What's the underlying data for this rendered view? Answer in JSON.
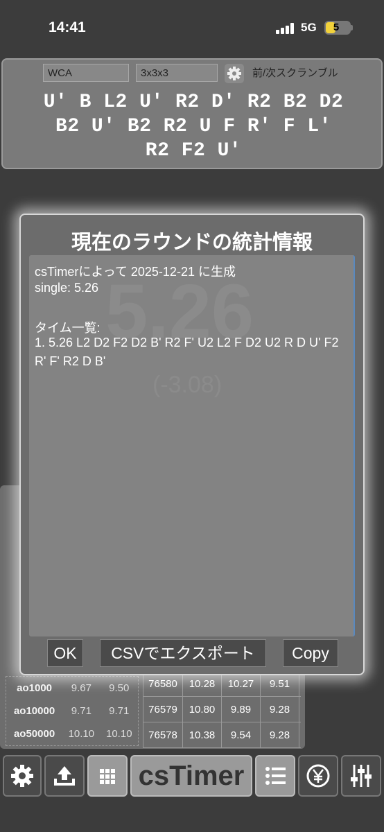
{
  "status": {
    "time": "14:41",
    "network": "5G",
    "battery": "5"
  },
  "scramble": {
    "event_field": "WCA",
    "puzzle_field": "3x3x3",
    "link_label": "前/次スクランブル",
    "lines": [
      "U' B L2 U' R2 D' R2 B2 D2",
      "B2 U' B2 R2 U F R' F L'",
      "R2 F2 U'"
    ]
  },
  "background": {
    "ghost_time": "5.26",
    "ghost_delta": "(-3.08)",
    "ao_rows": [
      {
        "label": "ao1000",
        "v1": "9.67",
        "v2": "9.50"
      },
      {
        "label": "ao10000",
        "v1": "9.71",
        "v2": "9.71"
      },
      {
        "label": "ao50000",
        "v1": "10.10",
        "v2": "10.10"
      }
    ],
    "time_rows": [
      {
        "n": "76580",
        "a": "10.28",
        "b": "10.27",
        "c": "9.51"
      },
      {
        "n": "76579",
        "a": "10.80",
        "b": "9.89",
        "c": "9.28"
      },
      {
        "n": "76578",
        "a": "10.38",
        "b": "9.54",
        "c": "9.28"
      }
    ]
  },
  "modal": {
    "title": "現在のラウンドの統計情報",
    "line1": "csTimerによって 2025-12-21 に生成",
    "line2": "single: 5.26",
    "line3": "タイム一覧:",
    "line4": "1. 5.26   L2 D2 F2 D2 B' R2 F' U2 L2 F D2 U2 R D U' F2 R' F' R2 D B'",
    "ok_label": "OK",
    "csv_label": "CSVでエクスポート",
    "copy_label": "Copy"
  },
  "toolbar": {
    "logo": "csTimer"
  }
}
